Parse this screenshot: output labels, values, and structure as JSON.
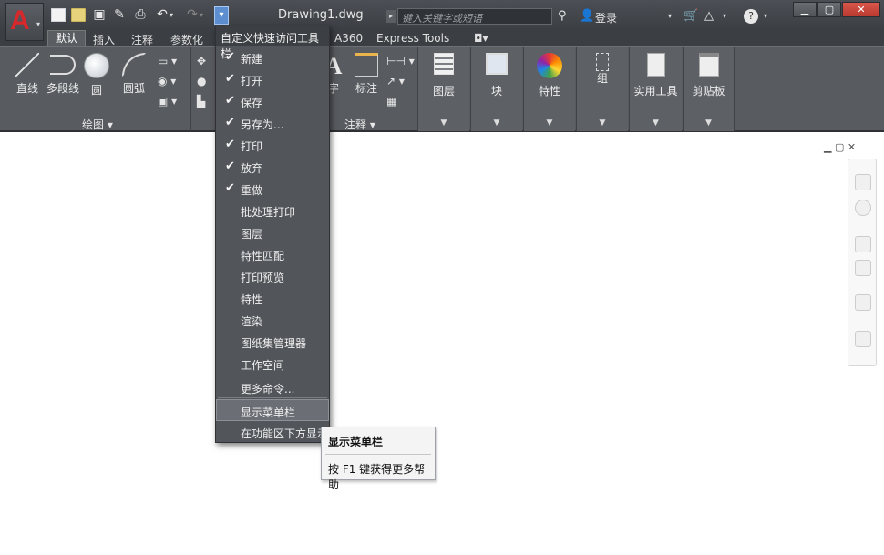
{
  "titlebar": {
    "app_letter": "A",
    "document_title": "Drawing1.dwg",
    "search_placeholder": "键入关键字或短语",
    "login_label": "登录",
    "help_symbol": "?"
  },
  "qat_icons": [
    "new-icon",
    "open-icon",
    "save-icon",
    "saveas-icon",
    "print-icon",
    "undo-icon",
    "redo-icon",
    "customize-dropdown-icon"
  ],
  "tabs": [
    "默认",
    "插入",
    "注释",
    "参数化",
    "A360",
    "Express Tools"
  ],
  "ribbon": {
    "draw_buttons": [
      "直线",
      "多段线",
      "圆",
      "圆弧"
    ],
    "draw_panel_title": "绘图 ▾",
    "annotation_buttons": [
      "字",
      "标注"
    ],
    "annotation_panel_title": "注释 ▾",
    "big_buttons": [
      "图层",
      "块",
      "特性",
      "组",
      "实用工具",
      "剪贴板"
    ]
  },
  "menu": {
    "header": "自定义快速访问工具栏",
    "checked_items": [
      "新建",
      "打开",
      "保存",
      "另存为...",
      "打印",
      "放弃",
      "重做"
    ],
    "unchecked_items": [
      "批处理打印",
      "图层",
      "特性匹配",
      "打印预览",
      "特性",
      "渲染",
      "图纸集管理器",
      "工作空间"
    ],
    "more_commands": "更多命令...",
    "show_menubar": "显示菜单栏",
    "show_below_ribbon": "在功能区下方显示"
  },
  "tooltip": {
    "title": "显示菜单栏",
    "help": "按 F1 键获得更多帮助"
  },
  "colors": {
    "titlebar": "#3f4247",
    "ribbon": "#585b60",
    "logo_red": "#d8282b",
    "menu_bg": "#52555a",
    "highlight": "#6b6e74"
  }
}
